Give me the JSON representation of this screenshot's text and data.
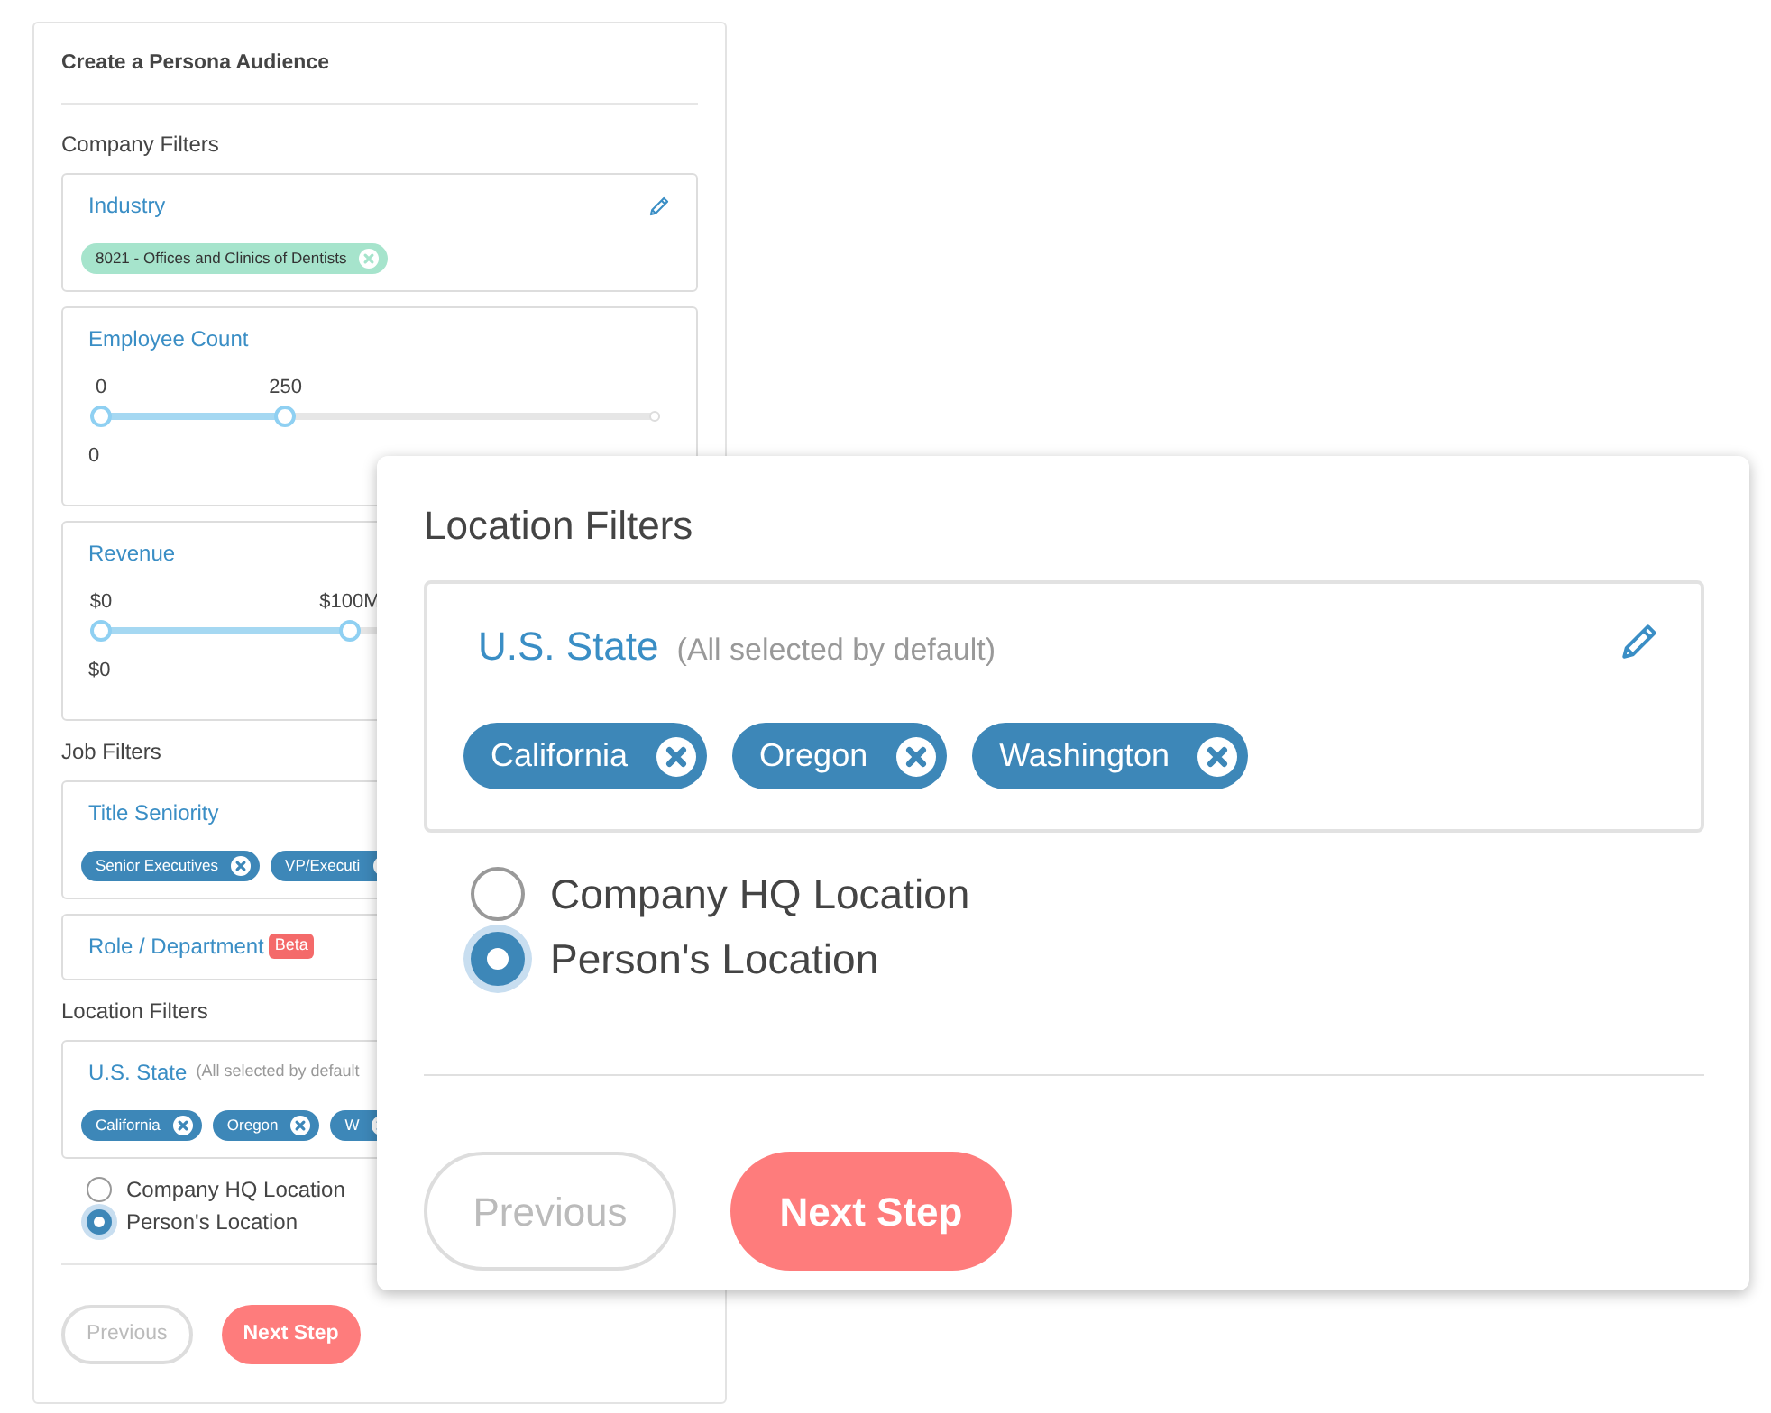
{
  "background_panel": {
    "title": "Create a Persona Audience",
    "sections": [
      {
        "heading": "Company Filters",
        "filters": [
          {
            "kind": "tags",
            "title": "Industry",
            "editable": true,
            "tags": [
              {
                "label": "8021 - Offices and Clinics of Dentists",
                "color": "#a6e4cc"
              }
            ]
          },
          {
            "kind": "range",
            "title": "Employee Count",
            "min_label": "0",
            "max_label": "250",
            "low_label": "0",
            "level": 0.33,
            "end_marker": true
          },
          {
            "kind": "range",
            "title": "Revenue",
            "min_label": "$0",
            "max_label": "$100M",
            "low_label": "$0",
            "level": 0.445
          }
        ]
      },
      {
        "heading": "Job Filters",
        "filters": [
          {
            "kind": "tags",
            "title": "Title Seniority",
            "tags": [
              {
                "label": "Senior Executives",
                "color": "#3d87b8"
              },
              {
                "label": "VP/Executi",
                "color": "#3d87b8"
              }
            ]
          },
          {
            "kind": "plain",
            "title": "Role / Department",
            "badge": "Beta"
          }
        ]
      },
      {
        "heading": "Location Filters",
        "filters": [
          {
            "kind": "tags",
            "title": "U.S. State",
            "note": "(All selected by default",
            "tags": [
              {
                "label": "California",
                "color": "#3d87b8"
              },
              {
                "label": "Oregon",
                "color": "#3d87b8"
              },
              {
                "label": "W",
                "color": "#3d87b8"
              }
            ]
          }
        ]
      }
    ],
    "radios": [
      {
        "label": "Company HQ Location",
        "selected": false
      },
      {
        "label": "Person's Location",
        "selected": true
      }
    ],
    "buttons": [
      {
        "label": "Previous",
        "kind": "secondary"
      },
      {
        "label": "Next Step",
        "kind": "primary"
      }
    ]
  },
  "location_dialog": {
    "title": "Location Filters",
    "filter": {
      "title": "U.S. State",
      "note": "(All selected by default)",
      "editable": true,
      "tags": [
        {
          "label": "California",
          "color": "#3d87b8"
        },
        {
          "label": "Oregon",
          "color": "#3d87b8"
        },
        {
          "label": "Washington",
          "color": "#3d87b8"
        }
      ]
    },
    "radios": [
      {
        "label": "Company HQ Location",
        "selected": false
      },
      {
        "label": "Person's Location",
        "selected": true
      }
    ],
    "buttons": [
      {
        "label": "Previous",
        "kind": "secondary"
      },
      {
        "label": "Next Step",
        "kind": "primary"
      }
    ]
  }
}
